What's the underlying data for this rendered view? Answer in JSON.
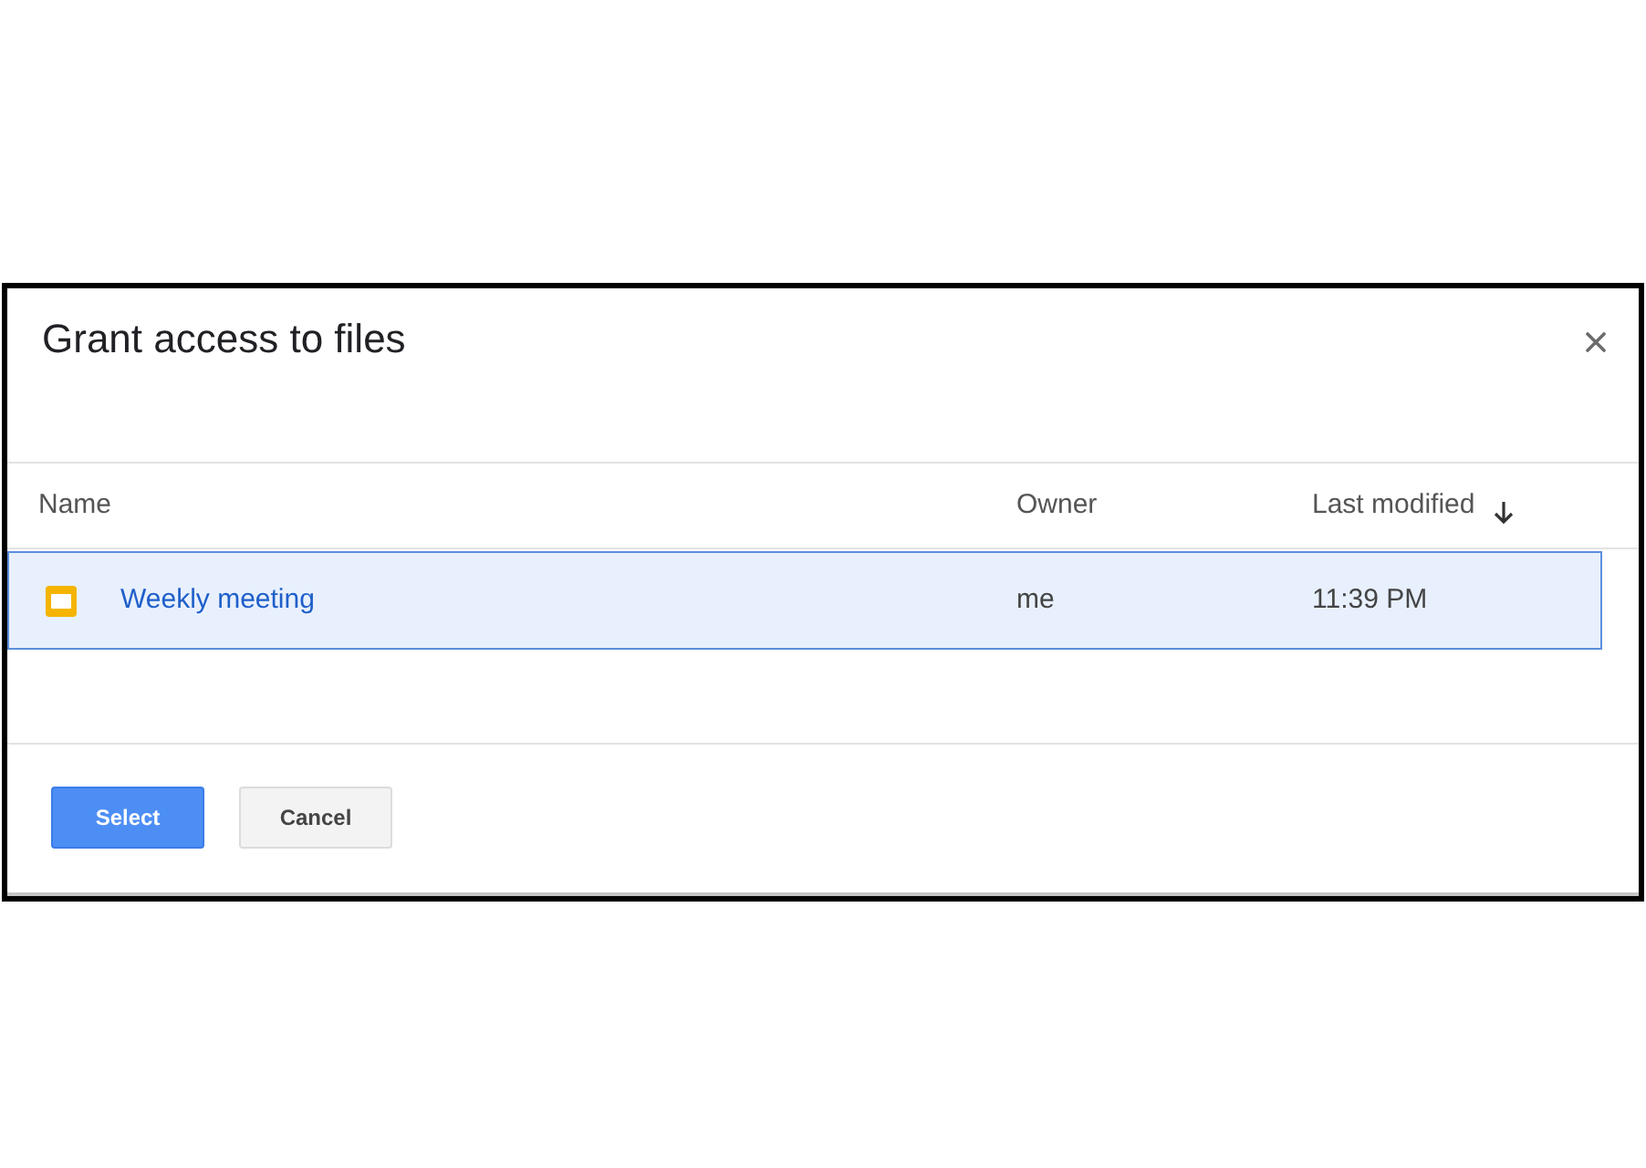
{
  "dialog": {
    "title": "Grant access to files"
  },
  "table": {
    "columns": [
      {
        "label": "Name",
        "sorted": false
      },
      {
        "label": "Owner",
        "sorted": false
      },
      {
        "label": "Last modified",
        "sorted": true
      }
    ],
    "rows": [
      {
        "name": "Weekly meeting",
        "owner": "me",
        "modified": "11:39 PM",
        "selected": true
      }
    ]
  },
  "buttons": [
    {
      "label": "Select",
      "kind": "primary"
    },
    {
      "label": "Cancel",
      "kind": "secondary"
    }
  ]
}
